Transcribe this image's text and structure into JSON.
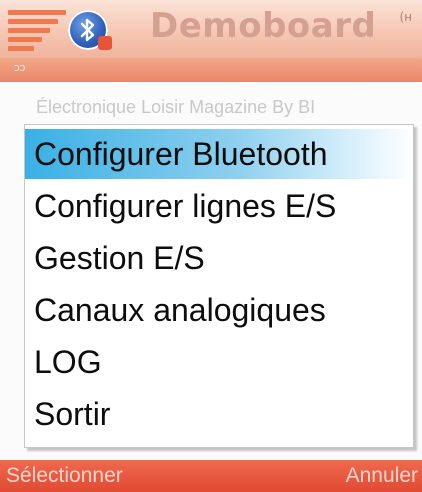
{
  "titlebar": {
    "title": "Demoboard",
    "signal_glyph": "(ʜ",
    "logo_icon": "operator-logo-stripes-icon",
    "bluetooth_icon": "bluetooth-icon"
  },
  "strip": {
    "glyph": "ƆƆ"
  },
  "background_text": "Électronique Loisir Magazine By BI",
  "menu": {
    "items": [
      {
        "label": "Configurer Bluetooth",
        "selected": true
      },
      {
        "label": "Configurer lignes E/S",
        "selected": false
      },
      {
        "label": "Gestion E/S",
        "selected": false
      },
      {
        "label": "Canaux analogiques",
        "selected": false
      },
      {
        "label": "LOG",
        "selected": false
      },
      {
        "label": "Sortir",
        "selected": false
      }
    ]
  },
  "softkeys": {
    "left": "Sélectionner",
    "right": "Annuler"
  },
  "colors": {
    "accent_selection": "#39b0e4",
    "softkey_bar": "#e14a33",
    "titlebar": "#f6c7b3"
  }
}
